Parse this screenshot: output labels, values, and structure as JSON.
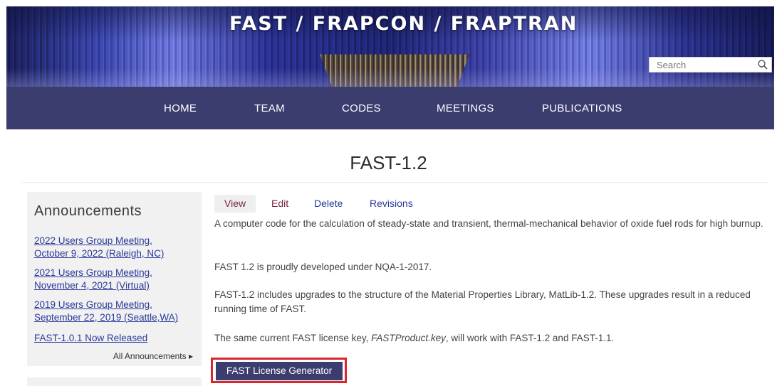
{
  "site": {
    "title": "FAST / FRAPCON / FRAPTRAN"
  },
  "search": {
    "placeholder": "Search",
    "icon": "search-icon"
  },
  "nav": {
    "items": [
      {
        "label": "HOME"
      },
      {
        "label": "TEAM"
      },
      {
        "label": "CODES"
      },
      {
        "label": "MEETINGS"
      },
      {
        "label": "PUBLICATIONS"
      }
    ]
  },
  "page": {
    "title": "FAST-1.2"
  },
  "sidebar": {
    "heading": "Announcements",
    "items": [
      {
        "line1": "2022 Users Group Meeting,",
        "line2": "October 9, 2022 (Raleigh, NC)"
      },
      {
        "line1": "2021 Users Group Meeting,",
        "line2": "November 4, 2021 (Virtual)"
      },
      {
        "line1": "2019 Users Group Meeting,",
        "line2": "September 22, 2019 (Seattle,WA)"
      },
      {
        "line1": "FAST-1.0.1 Now Released"
      }
    ],
    "all_link": "All Announcements ▸"
  },
  "tabs": [
    {
      "label": "View"
    },
    {
      "label": "Edit"
    },
    {
      "label": "Delete"
    },
    {
      "label": "Revisions"
    }
  ],
  "content": {
    "p1": "A computer code for the calculation of steady-state and transient, thermal-mechanical behavior of oxide fuel rods for high burnup.",
    "p2": "FAST 1.2 is proudly developed under NQA-1-2017.",
    "p3": "FAST-1.2 includes upgrades to the structure of the Material Properties Library, MatLib-1.2.  These upgrades result in a reduced running time of FAST.",
    "p4_before": "The same current FAST license key, ",
    "p4_key": "FASTProduct.key",
    "p4_after": ", will work with FAST-1.2 and FAST-1.1.",
    "button": "FAST License Generator"
  },
  "colors": {
    "nav_bg": "#3b3d6e",
    "link": "#2a3a99",
    "tab_active": "#7a2444",
    "highlight": "#d8262c"
  }
}
